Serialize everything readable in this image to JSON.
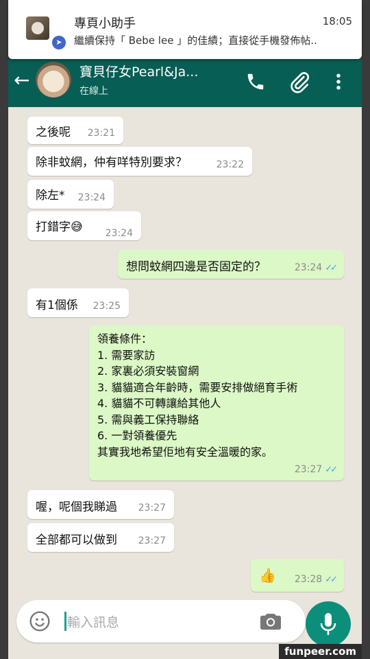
{
  "notification": {
    "title": "專頁小助手",
    "time": "18:05",
    "body": "繼續保持「 Bebe lee 」的佳績；直接從手機發佈帖.."
  },
  "header": {
    "contact_name": "寶貝仔女Pearl&Ja...",
    "status": "在線上"
  },
  "messages": [
    {
      "text": "之後呢",
      "time": "23:21"
    },
    {
      "text": "除非蚊網，仲有咩特別要求？",
      "time": "23:22"
    },
    {
      "text": "除左*",
      "time": "23:24"
    },
    {
      "text": "打錯字😅",
      "time": "23:24"
    },
    {
      "text": "想問蚊網四邊是否固定的？",
      "time": "23:24"
    },
    {
      "text": "有1個係",
      "time": "23:25"
    },
    {
      "time": "23:27",
      "lines": [
        "領養條件：",
        "1.  需要家訪",
        "2.  家裏必須安裝窗網",
        "3.  貓貓適合年齡時，需要安排做絕育手術",
        "4.  貓貓不可轉讓給其他人",
        "5.  需與義工保持聯絡",
        "6.  一對領養優先",
        "其實我地希望佢地有安全溫暖的家。"
      ]
    },
    {
      "text": "喔，呢個我睇過",
      "time": "23:27"
    },
    {
      "text": "全部都可以做到",
      "time": "23:27"
    },
    {
      "text": "👍",
      "time": "23:28"
    }
  ],
  "input": {
    "placeholder": "輸入訊息"
  },
  "watermark": "funpeer.com",
  "colors": {
    "header": "#075e54",
    "outgoing": "#dcf8c6",
    "incoming": "#ffffff",
    "accent": "#0b8f7b",
    "ticks": "#3fa8e8"
  },
  "icons": [
    "back-arrow-icon",
    "phone-icon",
    "paperclip-icon",
    "more-vertical-icon",
    "emoji-icon",
    "camera-icon",
    "microphone-icon",
    "read-ticks-icon",
    "navigation-badge-icon"
  ]
}
